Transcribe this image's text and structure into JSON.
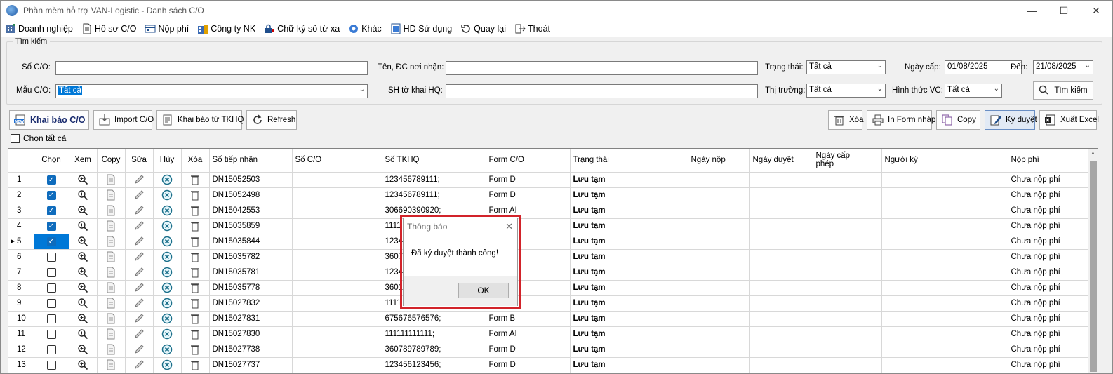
{
  "window": {
    "title": "Phần mềm hỗ trợ VAN-Logistic - Danh sách C/O"
  },
  "menu": [
    {
      "label": "Doanh nghiệp",
      "icon": "building-icon"
    },
    {
      "label": "Hồ sơ C/O",
      "icon": "document-icon"
    },
    {
      "label": "Nộp phí",
      "icon": "payment-icon"
    },
    {
      "label": "Công ty NK",
      "icon": "company-icon"
    },
    {
      "label": "Chữ ký số từ xa",
      "icon": "lock-user-icon"
    },
    {
      "label": "Khác",
      "icon": "gear-icon"
    },
    {
      "label": "HD Sử dụng",
      "icon": "help-doc-icon"
    },
    {
      "label": "Quay lại",
      "icon": "back-icon"
    },
    {
      "label": "Thoát",
      "icon": "exit-icon"
    }
  ],
  "search": {
    "legend": "Tìm kiếm",
    "so_co_label": "Số C/O:",
    "so_co_value": "",
    "ten_dc_label": "Tên, ĐC nơi nhận:",
    "ten_dc_value": "",
    "trang_thai_label": "Trạng thái:",
    "trang_thai_value": "Tất cả",
    "ngay_cap_label": "Ngày cấp:",
    "ngay_cap_value": "01/08/2025",
    "den_label": "Đến:",
    "den_value": "21/08/2025",
    "mau_co_label": "Mẫu C/O:",
    "mau_co_value": "Tất cả",
    "sh_to_khai_label": "SH tờ khai HQ:",
    "sh_to_khai_value": "",
    "thi_truong_label": "Thị trường:",
    "thi_truong_value": "Tất cả",
    "hinh_thuc_label": "Hình thức VC:",
    "hinh_thuc_value": "Tất cả",
    "search_button": "Tìm kiếm"
  },
  "toolbar": {
    "khai_bao": "Khai báo C/O",
    "new_badge": "NEW",
    "import": "Import C/O",
    "khai_bao_tkhq": "Khai báo từ TKHQ",
    "refresh": "Refresh",
    "xoa": "Xóa",
    "in_form": "In Form nháp",
    "copy": "Copy",
    "ky_duyet": "Ký duyệt",
    "xuat_excel": "Xuất Excel",
    "chon_tat_ca": "Chọn tất cả"
  },
  "grid": {
    "columns": {
      "chon": "Chọn",
      "xem": "Xem",
      "copy": "Copy",
      "sua": "Sửa",
      "huy": "Hủy",
      "xoa": "Xóa",
      "so_tiep_nhan": "Số tiếp nhận",
      "so_co": "Số C/O",
      "so_tkhq": "Số TKHQ",
      "form": "Form C/O",
      "trang_thai": "Trạng thái",
      "ngay_nop": "Ngày nộp",
      "ngay_duyet": "Ngày duyệt",
      "ngay_cap_phep": "Ngày cấp phép",
      "nguoi_ky": "Người ký",
      "nop_phi": "Nộp phí"
    },
    "rows": [
      {
        "n": "1",
        "chk": true,
        "so_tiep_nhan": "DN15052503",
        "so_co": "",
        "so_tkhq": "123456789111;",
        "form": "Form D",
        "trang_thai": "Lưu tạm",
        "nop_phi": "Chưa nộp phí"
      },
      {
        "n": "2",
        "chk": true,
        "so_tiep_nhan": "DN15052498",
        "so_co": "",
        "so_tkhq": "123456789111;",
        "form": "Form D",
        "trang_thai": "Lưu tạm",
        "nop_phi": "Chưa nộp phí"
      },
      {
        "n": "3",
        "chk": true,
        "so_tiep_nhan": "DN15042553",
        "so_co": "",
        "so_tkhq": "306690390920;",
        "form": "Form AI",
        "trang_thai": "Lưu tạm",
        "nop_phi": "Chưa nộp phí"
      },
      {
        "n": "4",
        "chk": true,
        "so_tiep_nhan": "DN15035859",
        "so_co": "",
        "so_tkhq": "1111",
        "form": "",
        "trang_thai": "Lưu tạm",
        "nop_phi": "Chưa nộp phí"
      },
      {
        "n": "5",
        "chk": true,
        "current": true,
        "so_tiep_nhan": "DN15035844",
        "so_co": "",
        "so_tkhq": "1234",
        "form": "",
        "trang_thai": "Lưu tạm",
        "nop_phi": "Chưa nộp phí"
      },
      {
        "n": "6",
        "chk": false,
        "so_tiep_nhan": "DN15035782",
        "so_co": "",
        "so_tkhq": "3607",
        "form": "",
        "trang_thai": "Lưu tạm",
        "nop_phi": "Chưa nộp phí"
      },
      {
        "n": "7",
        "chk": false,
        "so_tiep_nhan": "DN15035781",
        "so_co": "",
        "so_tkhq": "1234",
        "form": "",
        "trang_thai": "Lưu tạm",
        "nop_phi": "Chưa nộp phí"
      },
      {
        "n": "8",
        "chk": false,
        "so_tiep_nhan": "DN15035778",
        "so_co": "",
        "so_tkhq": "3601",
        "form": "",
        "trang_thai": "Lưu tạm",
        "nop_phi": "Chưa nộp phí"
      },
      {
        "n": "9",
        "chk": false,
        "so_tiep_nhan": "DN15027832",
        "so_co": "",
        "so_tkhq": "1111",
        "form": "",
        "trang_thai": "Lưu tạm",
        "nop_phi": "Chưa nộp phí"
      },
      {
        "n": "10",
        "chk": false,
        "so_tiep_nhan": "DN15027831",
        "so_co": "",
        "so_tkhq": "675676576576;",
        "form": "Form B",
        "trang_thai": "Lưu tạm",
        "nop_phi": "Chưa nộp phí"
      },
      {
        "n": "11",
        "chk": false,
        "so_tiep_nhan": "DN15027830",
        "so_co": "",
        "so_tkhq": "111111111111;",
        "form": "Form AI",
        "trang_thai": "Lưu tạm",
        "nop_phi": "Chưa nộp phí"
      },
      {
        "n": "12",
        "chk": false,
        "so_tiep_nhan": "DN15027738",
        "so_co": "",
        "so_tkhq": "360789789789;",
        "form": "Form D",
        "trang_thai": "Lưu tạm",
        "nop_phi": "Chưa nộp phí"
      },
      {
        "n": "13",
        "chk": false,
        "so_tiep_nhan": "DN15027737",
        "so_co": "",
        "so_tkhq": "123456123456;",
        "form": "Form D",
        "trang_thai": "Lưu tạm",
        "nop_phi": "Chưa nộp phí"
      }
    ]
  },
  "dialog": {
    "title": "Thông báo",
    "message": "Đã ký duyệt thành công!",
    "ok": "OK"
  },
  "colors": {
    "accent": "#0078d7",
    "highlight_frame": "#d2232a",
    "toolbar_blue": "#1a2c6e"
  }
}
